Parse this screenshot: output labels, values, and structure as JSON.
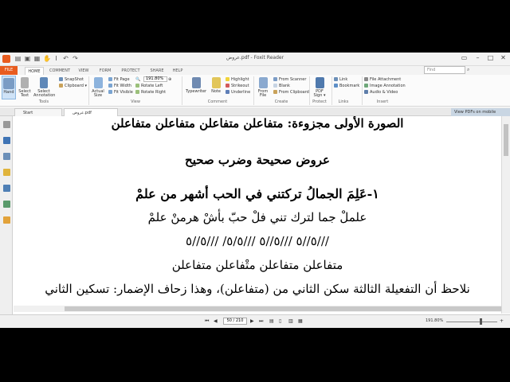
{
  "window": {
    "title": "عروض.pdf - Foxit Reader"
  },
  "menu_tabs": [
    "FILE",
    "HOME",
    "COMMENT",
    "VIEW",
    "FORM",
    "PROTECT",
    "SHARE",
    "HELP"
  ],
  "search": {
    "placeholder": "Find"
  },
  "ribbon": {
    "hand": "Hand",
    "select_text": [
      "Select",
      "Text"
    ],
    "select_annotation": [
      "Select",
      "Annotation"
    ],
    "snapshot": "SnapShot",
    "clipboard": "Clipboard",
    "actual_size": [
      "Actual",
      "Size"
    ],
    "fit_page": "Fit Page",
    "fit_width": "Fit Width",
    "fit_visible": "Fit Visible",
    "zoom_value": "191.80%",
    "rotate_left": "Rotate Left",
    "rotate_right": "Rotate Right",
    "typewriter": "Typewriter",
    "note": "Note",
    "highlight": "Highlight",
    "strikeout": "Strikeout",
    "underline": "Underline",
    "from_file": [
      "From",
      "File"
    ],
    "from_scanner": "From Scanner",
    "blank": "Blank",
    "from_clipboard": "From Clipboard",
    "pdf_sign": [
      "PDF",
      "Sign ▾"
    ],
    "link": "Link",
    "bookmark": "Bookmark",
    "file_attachment": "File Attachment",
    "image_annotation": "Image Annotation",
    "audio_video": "Audio & Video",
    "groups": [
      "Tools",
      "View",
      "Comment",
      "Create",
      "Protect",
      "Links",
      "Insert"
    ]
  },
  "doc_tabs": [
    "Start",
    "عروض.pdf"
  ],
  "promo": "View PDFs on mobile devices",
  "document": {
    "lines": [
      "الصورة الأولى مجزوءة: متفاعلن متفاعلن متفاعلن متفاعلن",
      "عروض صحيحة وضرب صحيح",
      "١-عَلِمَ الجمالُ تركتني  في الحب أشهر من علمْ",
      "علملْ جما لترك تني  فلْ حبّ بأشْ هرمنْ علمْ",
      "///٥//٥  ///٥//٥  ///٥/٥/  ///٥//٥",
      "متفاعلن متفاعلن  متْفاعلن متفاعلن",
      "نلاحظ أن التفعيلة الثالثة سكن الثاني من (متفاعلن)، وهذا زحاف الإضمار: تسكين الثاني"
    ]
  },
  "status": {
    "page_display": "50 / 210",
    "zoom": "191.80%"
  }
}
